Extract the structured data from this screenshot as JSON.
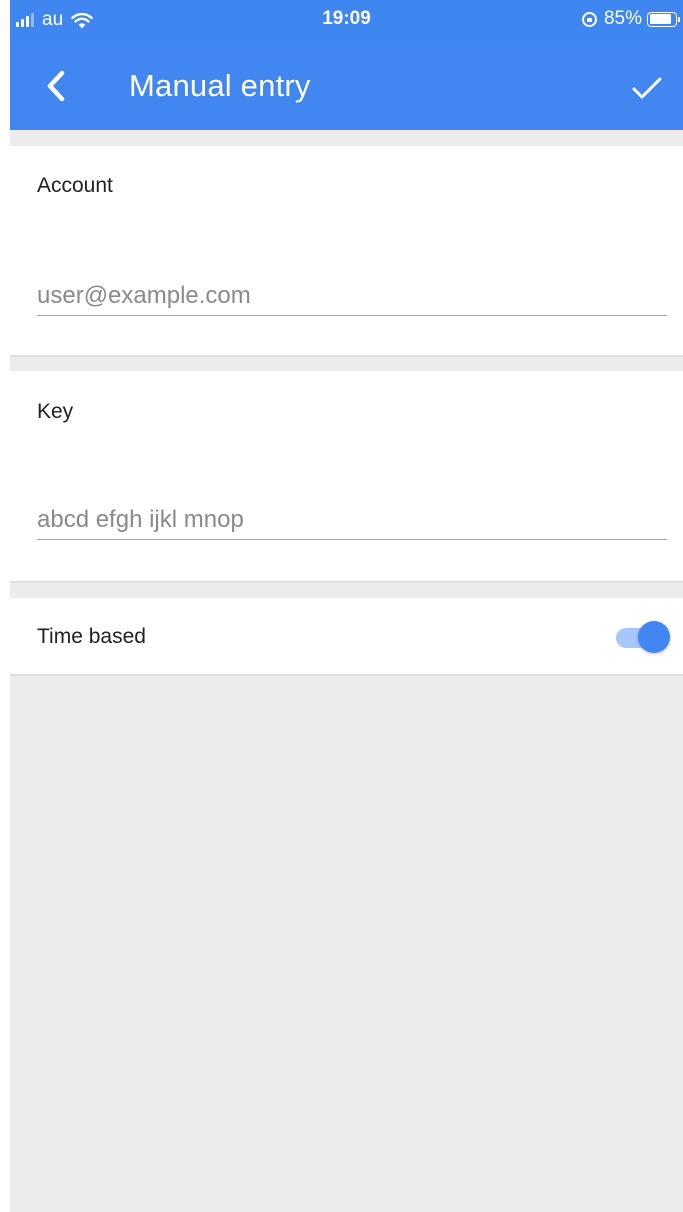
{
  "status_bar": {
    "carrier": "au",
    "time": "19:09",
    "battery_percent": "85%",
    "battery_level": 0.85
  },
  "app_bar": {
    "title": "Manual entry",
    "back_icon": "chevron-left-icon",
    "confirm_icon": "checkmark-icon",
    "color": "#4186f1"
  },
  "form": {
    "account": {
      "label": "Account",
      "placeholder": "user@example.com",
      "value": ""
    },
    "key": {
      "label": "Key",
      "placeholder": "abcd efgh ijkl mnop",
      "value": ""
    },
    "time_based": {
      "label": "Time based",
      "enabled": true
    }
  }
}
